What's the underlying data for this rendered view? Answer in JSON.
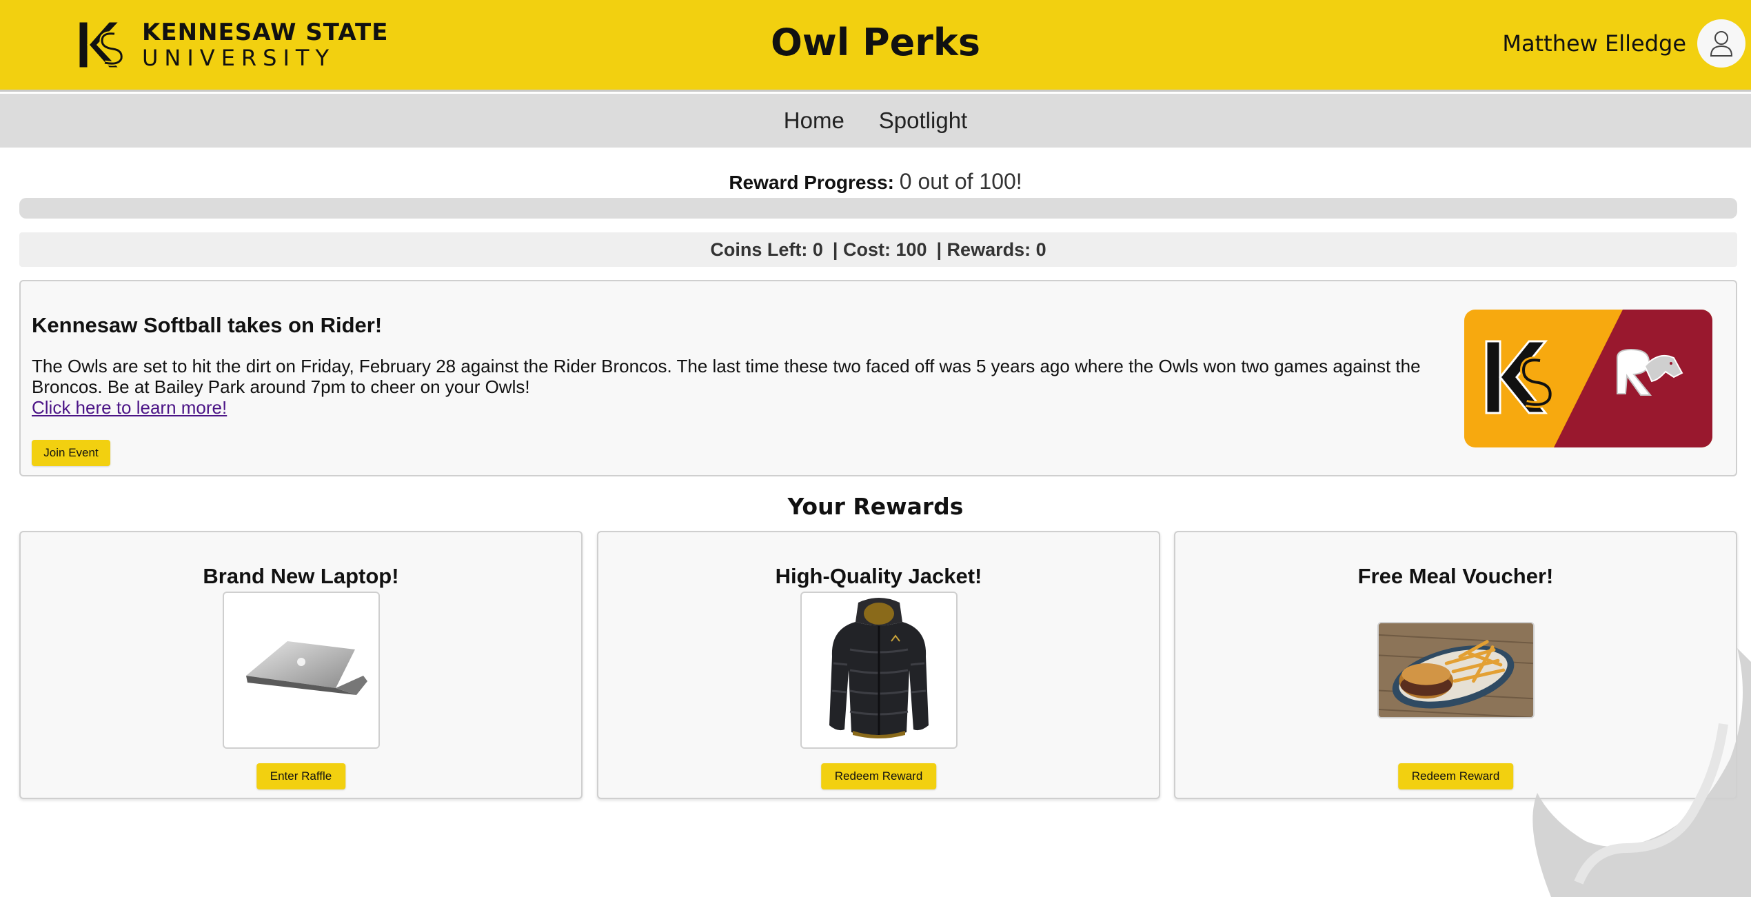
{
  "header": {
    "logo_line1": "KENNESAW STATE",
    "logo_line2": "UNIVERSITY",
    "app_title": "Owl Perks",
    "user_name": "Matthew Elledge"
  },
  "nav": {
    "items": [
      {
        "label": "Home"
      },
      {
        "label": "Spotlight"
      }
    ]
  },
  "progress": {
    "label": "Reward Progress:",
    "value_text": "0 out of 100!",
    "current": 0,
    "max": 100
  },
  "stats": {
    "coins": "Coins Left: 0",
    "cost": "| Cost: 100",
    "rewards": "| Rewards: 0"
  },
  "event": {
    "title": "Kennesaw Softball takes on Rider!",
    "description": "The Owls are set to hit the dirt on Friday, February 28 against the Rider Broncos. The last time these two faced off was 5 years ago where the Owls won two games against the Broncos. Be at Bailey Park around 7pm to cheer on your Owls!",
    "link_text": "Click here to learn more!",
    "button_label": "Join Event",
    "image_colors": {
      "left": "#f7a90f",
      "right": "#99182e"
    }
  },
  "rewards_section": {
    "heading": "Your Rewards",
    "items": [
      {
        "title": "Brand New Laptop!",
        "button": "Enter Raffle",
        "icon": "laptop-image"
      },
      {
        "title": "High-Quality Jacket!",
        "button": "Redeem Reward",
        "icon": "jacket-image"
      },
      {
        "title": "Free Meal Voucher!",
        "button": "Redeem Reward",
        "icon": "meal-image"
      }
    ]
  },
  "colors": {
    "brand_yellow": "#f2d010",
    "nav_gray": "#dcdcdc",
    "link_purple": "#4b1486"
  }
}
